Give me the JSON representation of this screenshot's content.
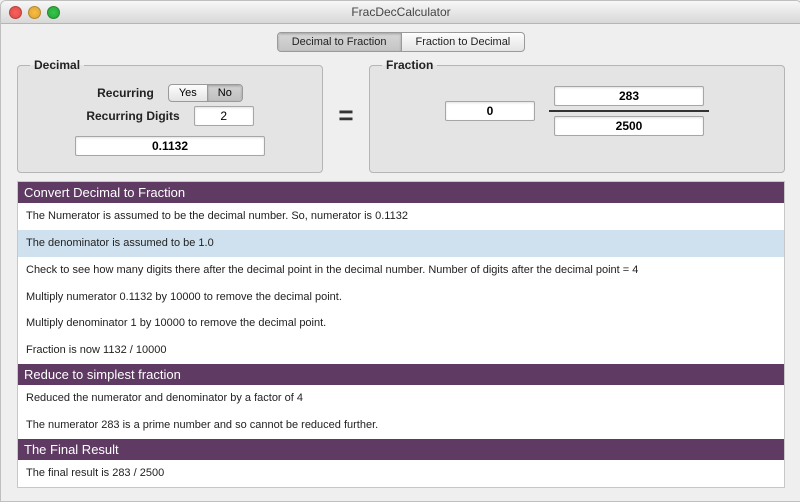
{
  "window": {
    "title": "FracDecCalculator"
  },
  "tabs": {
    "dec2frac": "Decimal to Fraction",
    "frac2dec": "Fraction to Decimal",
    "active": "dec2frac"
  },
  "decimal": {
    "legend": "Decimal",
    "recurring_label": "Recurring",
    "yes": "Yes",
    "no": "No",
    "recurring_active": "no",
    "recurring_digits_label": "Recurring Digits",
    "recurring_digits_value": "2",
    "value": "0.1132"
  },
  "equals": "=",
  "fraction": {
    "legend": "Fraction",
    "whole": "0",
    "numerator": "283",
    "denominator": "2500"
  },
  "steps": {
    "sections": [
      {
        "heading": "Convert Decimal to Fraction",
        "paras": [
          {
            "t": "The Numerator is assumed to be the decimal number.  So, numerator is 0.1132",
            "hl": false
          },
          {
            "t": "The denominator is assumed to be 1.0",
            "hl": true
          },
          {
            "t": "Check to see how many digits there after the decimal point in the decimal number. Number of digits after the decimal point = 4",
            "hl": false
          },
          {
            "t": "Multiply numerator 0.1132 by 10000 to remove the decimal point.",
            "hl": false
          },
          {
            "t": "Multiply denominator 1 by 10000 to remove the decimal point.",
            "hl": false
          },
          {
            "t": "Fraction is now 1132 / 10000",
            "hl": false
          }
        ]
      },
      {
        "heading": "Reduce to simplest fraction",
        "paras": [
          {
            "t": "Reduced the numerator and denominator by a factor of 4",
            "hl": false
          },
          {
            "t": "The numerator 283 is a prime number and so cannot be reduced further.",
            "hl": false
          }
        ]
      },
      {
        "heading": "The Final Result",
        "paras": [
          {
            "t": "The final result is 283 / 2500",
            "hl": false
          }
        ]
      }
    ]
  }
}
